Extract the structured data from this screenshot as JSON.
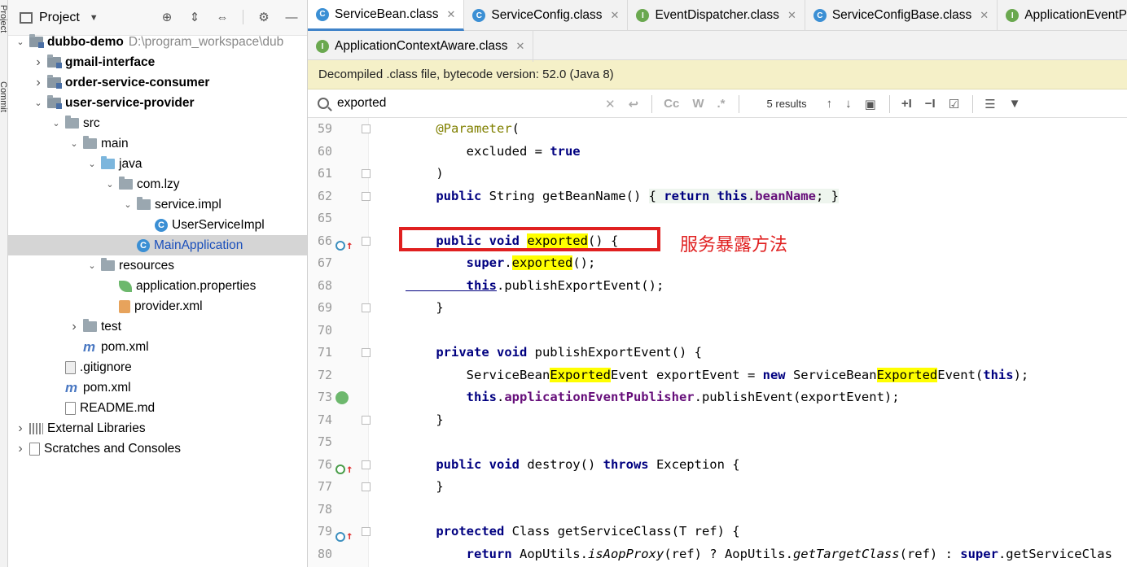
{
  "tool_strip": {
    "label_project": "Project",
    "label_commit": "Commit"
  },
  "project_panel": {
    "title": "Project",
    "tree": [
      {
        "label": "dubbo-demo",
        "path": "D:\\program_workspace\\dub",
        "depth": 0,
        "expanded": true,
        "icon": "module-folder-icon",
        "bold": true
      },
      {
        "label": "gmail-interface",
        "depth": 1,
        "expanded": false,
        "icon": "module-folder-icon",
        "bold": true
      },
      {
        "label": "order-service-consumer",
        "depth": 1,
        "expanded": false,
        "icon": "module-folder-icon",
        "bold": true
      },
      {
        "label": "user-service-provider",
        "depth": 1,
        "expanded": true,
        "icon": "module-folder-icon",
        "bold": true
      },
      {
        "label": "src",
        "depth": 2,
        "expanded": true,
        "icon": "folder-icon"
      },
      {
        "label": "main",
        "depth": 3,
        "expanded": true,
        "icon": "folder-icon"
      },
      {
        "label": "java",
        "depth": 4,
        "expanded": true,
        "icon": "source-folder-icon"
      },
      {
        "label": "com.lzy",
        "depth": 5,
        "expanded": true,
        "icon": "package-icon"
      },
      {
        "label": "service.impl",
        "depth": 6,
        "expanded": true,
        "icon": "package-icon"
      },
      {
        "label": "UserServiceImpl",
        "depth": 7,
        "icon": "class-icon"
      },
      {
        "label": "MainApplication",
        "depth": 6,
        "icon": "spring-class-icon",
        "selected": true
      },
      {
        "label": "resources",
        "depth": 4,
        "expanded": true,
        "icon": "resources-folder-icon"
      },
      {
        "label": "application.properties",
        "depth": 5,
        "icon": "properties-file-icon"
      },
      {
        "label": "provider.xml",
        "depth": 5,
        "icon": "xml-file-icon"
      },
      {
        "label": "test",
        "depth": 3,
        "expanded": false,
        "icon": "folder-icon"
      },
      {
        "label": "pom.xml",
        "depth": 3,
        "icon": "maven-icon"
      },
      {
        "label": ".gitignore",
        "depth": 2,
        "icon": "gitignore-file-icon"
      },
      {
        "label": "pom.xml",
        "depth": 2,
        "icon": "maven-icon"
      },
      {
        "label": "README.md",
        "depth": 2,
        "icon": "markdown-file-icon"
      },
      {
        "label": "External Libraries",
        "depth": 0,
        "expanded": false,
        "icon": "libraries-icon"
      },
      {
        "label": "Scratches and Consoles",
        "depth": 0,
        "expanded": false,
        "icon": "scratches-icon"
      }
    ]
  },
  "tabs_row1": [
    {
      "label": "ServiceBean.class",
      "type": "class",
      "active": true
    },
    {
      "label": "ServiceConfig.class",
      "type": "class"
    },
    {
      "label": "EventDispatcher.class",
      "type": "interface"
    },
    {
      "label": "ServiceConfigBase.class",
      "type": "class"
    },
    {
      "label": "ApplicationEventP",
      "type": "interface"
    }
  ],
  "tabs_row2": [
    {
      "label": "ApplicationContextAware.class",
      "type": "interface"
    }
  ],
  "banner": "Decompiled .class file, bytecode version: 52.0 (Java 8)",
  "search": {
    "value": "exported",
    "results": "5 results",
    "match_case": "Cc",
    "words": "W",
    "regex": ".*"
  },
  "code_lines": [
    {
      "num": "59",
      "tokens": [
        [
          "ann",
          "    @Parameter"
        ],
        [
          "",
          "("
        ]
      ],
      "fold": true
    },
    {
      "num": "60",
      "tokens": [
        [
          "",
          "        excluded = "
        ],
        [
          "kw",
          "true"
        ]
      ]
    },
    {
      "num": "61",
      "tokens": [
        [
          "",
          "    )"
        ]
      ],
      "fold": true
    },
    {
      "num": "62",
      "tokens": [
        [
          "kw",
          "    public "
        ],
        [
          "",
          "String getBeanName() "
        ],
        [
          "fold-bg",
          "{ "
        ],
        [
          "kw fold-bg",
          "return this"
        ],
        [
          "fold-bg",
          "."
        ],
        [
          "fld fold-bg",
          "beanName"
        ],
        [
          "fold-bg",
          "; }"
        ]
      ],
      "fold": true
    },
    {
      "num": "65",
      "tokens": []
    },
    {
      "num": "66",
      "tokens": [
        [
          "kw",
          "    public void "
        ],
        [
          "hl",
          "exported"
        ],
        [
          "",
          "() {"
        ]
      ],
      "gutter": "override",
      "fold": true
    },
    {
      "num": "67",
      "tokens": [
        [
          "kw",
          "        super"
        ],
        [
          "",
          "."
        ],
        [
          "hl",
          "exported"
        ],
        [
          "",
          "();"
        ]
      ]
    },
    {
      "num": "68",
      "tokens": [
        [
          "kw ul",
          "        this"
        ],
        [
          "",
          ".publishExportEvent();"
        ]
      ]
    },
    {
      "num": "69",
      "tokens": [
        [
          "",
          "    }"
        ]
      ],
      "fold": true
    },
    {
      "num": "70",
      "tokens": []
    },
    {
      "num": "71",
      "tokens": [
        [
          "kw",
          "    private void "
        ],
        [
          "",
          "publishExportEvent() {"
        ]
      ],
      "fold": true
    },
    {
      "num": "72",
      "tokens": [
        [
          "",
          "        ServiceBean"
        ],
        [
          "hl",
          "Exported"
        ],
        [
          "",
          "Event exportEvent = "
        ],
        [
          "kw",
          "new "
        ],
        [
          "",
          "ServiceBean"
        ],
        [
          "hl",
          "Exported"
        ],
        [
          "",
          "Event("
        ],
        [
          "kw",
          "this"
        ],
        [
          "",
          ");"
        ]
      ]
    },
    {
      "num": "73",
      "tokens": [
        [
          "kw",
          "        this"
        ],
        [
          "",
          "."
        ],
        [
          "fld",
          "applicationEventPublisher"
        ],
        [
          "",
          ".publishEvent(exportEvent);"
        ]
      ],
      "gutter": "leaf"
    },
    {
      "num": "74",
      "tokens": [
        [
          "",
          "    }"
        ]
      ],
      "fold": true
    },
    {
      "num": "75",
      "tokens": []
    },
    {
      "num": "76",
      "tokens": [
        [
          "kw",
          "    public void "
        ],
        [
          "",
          "destroy() "
        ],
        [
          "kw",
          "throws "
        ],
        [
          "",
          "Exception {"
        ]
      ],
      "gutter": "implements",
      "fold": true
    },
    {
      "num": "77",
      "tokens": [
        [
          "",
          "    }"
        ]
      ],
      "fold": true
    },
    {
      "num": "78",
      "tokens": []
    },
    {
      "num": "79",
      "tokens": [
        [
          "kw",
          "    protected "
        ],
        [
          "",
          "Class getServiceClass(T ref) {"
        ]
      ],
      "gutter": "override",
      "fold": true
    },
    {
      "num": "80",
      "tokens": [
        [
          "kw",
          "        return "
        ],
        [
          "",
          "AopUtils."
        ],
        [
          "it",
          "isAopProxy"
        ],
        [
          "",
          "(ref) ? AopUtils."
        ],
        [
          "it",
          "getTargetClass"
        ],
        [
          "",
          "(ref) : "
        ],
        [
          "kw",
          "super"
        ],
        [
          "",
          ".getServiceClas"
        ]
      ]
    }
  ],
  "annotation_text": "服务暴露方法",
  "colors": {
    "highlight": "#ffff00",
    "annotation_red": "#e02020",
    "keyword": "#000080",
    "banner_bg": "#f5f0c8"
  }
}
